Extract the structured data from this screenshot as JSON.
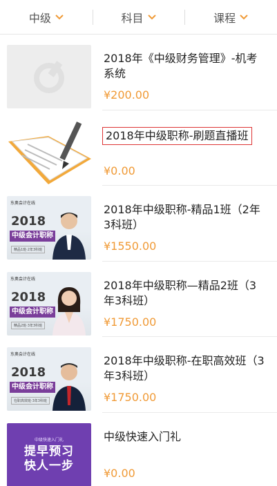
{
  "filters": [
    {
      "label": "中级"
    },
    {
      "label": "科目"
    },
    {
      "label": "课程"
    }
  ],
  "courses": [
    {
      "title": "2018年《中级财务管理》-机考系统",
      "price": "¥200.00",
      "thumb": "placeholder"
    },
    {
      "title": "2018年中级职称-刷题直播班",
      "price": "¥0.00",
      "thumb": "book-pencil"
    },
    {
      "title": "2018年中级职称-精品1班（2年3科班）",
      "price": "¥1550.00",
      "thumb": "teacher-male-1",
      "thumb_text": {
        "logo": "东奥会计在线",
        "year": "2018",
        "band": "中级会计职称",
        "sub": "精品1班·2年3科班"
      }
    },
    {
      "title": "2018年中级职称—精品2班（3年3科班）",
      "price": "¥1750.00",
      "thumb": "teacher-female",
      "thumb_text": {
        "logo": "东奥会计在线",
        "year": "2018",
        "band": "中级会计职称",
        "sub": "精品2班·3年3科班"
      }
    },
    {
      "title": "2018年中级职称-在职高效班（3年3科班）",
      "price": "¥1750.00",
      "thumb": "teacher-male-2",
      "thumb_text": {
        "logo": "东奥会计在线",
        "year": "2018",
        "band": "中级会计职称",
        "sub": "在职高效班·3年3科班"
      }
    },
    {
      "title": "中级快速入门礼",
      "price": "¥0.00",
      "thumb": "purple-promo",
      "thumb_text": {
        "line1": "中级快速入门礼",
        "line2a": "提早预习",
        "line2b": "快人一步"
      }
    }
  ],
  "colors": {
    "price": "#f09a36",
    "chevron": "#f09a36",
    "band": "#7a3e9a",
    "promo": "#6f3fb0"
  }
}
